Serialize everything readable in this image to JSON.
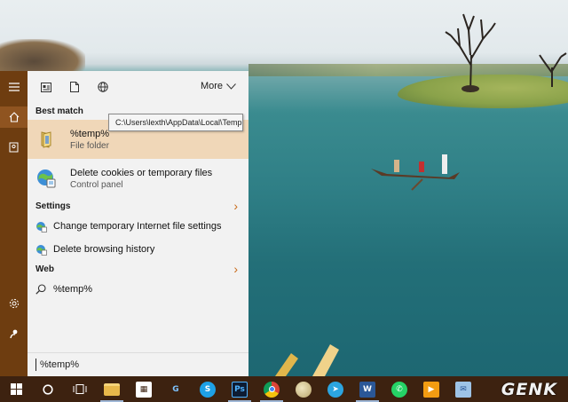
{
  "start_menu": {
    "toolbar": {
      "more_label": "More"
    },
    "best_match": {
      "heading": "Best match",
      "title": "%temp%",
      "subtitle": "File folder",
      "tooltip": "C:\\Users\\lexth\\AppData\\Local\\Temp"
    },
    "cookies": {
      "title": "Delete cookies or temporary files",
      "subtitle": "Control panel"
    },
    "settings": {
      "heading": "Settings",
      "items": [
        {
          "label": "Change temporary Internet file settings"
        },
        {
          "label": "Delete browsing history"
        }
      ]
    },
    "web": {
      "heading": "Web",
      "query": "%temp%"
    },
    "search": {
      "value": "%temp%"
    }
  },
  "taskbar": {
    "pinned": [
      "file-explorer",
      "store",
      "gotv",
      "skype",
      "photoshop",
      "chrome",
      "paint",
      "telegram",
      "word",
      "whatsapp",
      "media-player",
      "outlook"
    ]
  },
  "watermark": "GENK",
  "colors": {
    "accent": "#6e3d10",
    "selection": "#f0d7b8",
    "taskbar": "#3d2210"
  }
}
